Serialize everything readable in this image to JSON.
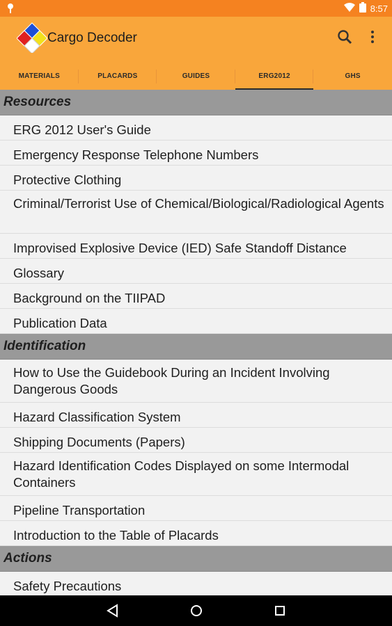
{
  "status": {
    "time": "8:57"
  },
  "app": {
    "title": "Cargo Decoder"
  },
  "tabs": [
    {
      "label": "MATERIALS"
    },
    {
      "label": "PLACARDS"
    },
    {
      "label": "GUIDES"
    },
    {
      "label": "ERG2012"
    },
    {
      "label": "GHS"
    }
  ],
  "sections": [
    {
      "title": "Resources",
      "items": [
        "ERG 2012 User's Guide",
        "Emergency Response Telephone Numbers",
        "Protective Clothing",
        "Criminal/Terrorist Use of Chemical/Biological/Radiological Agents",
        "Improvised Explosive Device (IED) Safe Standoff Distance",
        "Glossary",
        "Background on the TIIPAD",
        "Publication Data"
      ]
    },
    {
      "title": "Identification",
      "items": [
        "How to Use the Guidebook During an Incident Involving Dangerous Goods",
        "Hazard Classification System",
        "Shipping Documents (Papers)",
        "Hazard Identification Codes Displayed on some Intermodal Containers",
        "Pipeline Transportation",
        "Introduction to the Table of Placards"
      ]
    },
    {
      "title": "Actions",
      "items": [
        "Safety Precautions"
      ]
    }
  ]
}
